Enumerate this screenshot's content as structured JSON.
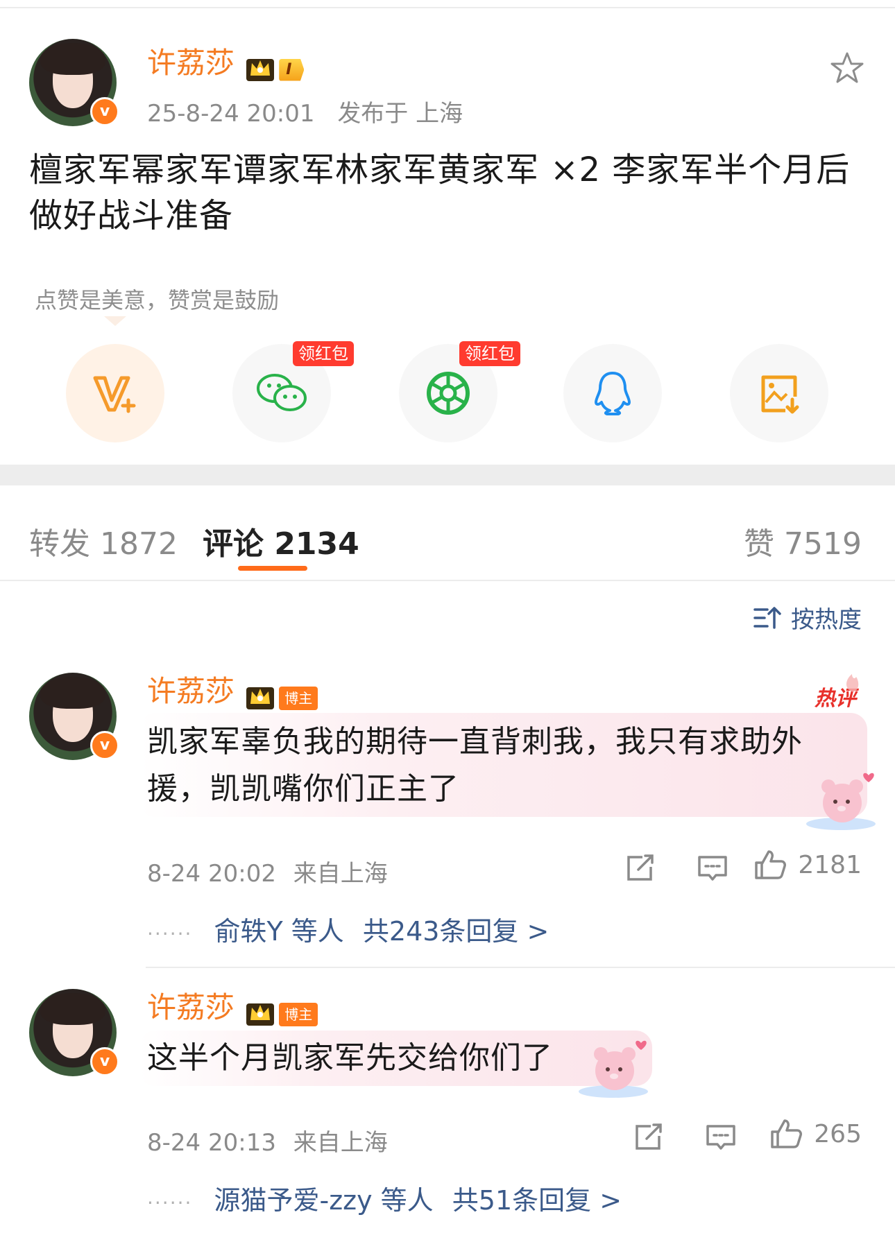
{
  "post": {
    "author": "许荔莎",
    "level_badge": "I",
    "time": "25-8-24 20:01",
    "location_label": "发布于 上海",
    "text_line1": "檀家军幂家军谭家军林家军黄家军 ×2 李家军半个月后",
    "text_line2": "做好战斗准备",
    "reward_tip": "点赞是美意，赞赏是鼓励"
  },
  "share": {
    "redpack_label_1": "领红包",
    "redpack_label_2": "领红包"
  },
  "tabs": {
    "repost": "转发 1872",
    "comment": "评论 2134",
    "like": "赞 7519"
  },
  "sort_label": "按热度",
  "comments": [
    {
      "author": "许荔莎",
      "badge": "博主",
      "hot_label": "热评",
      "line1": "凯家军辜负我的期待一直背刺我，我只有求助外",
      "line2": "援，凯凯嘴你们正主了",
      "time": "8-24 20:02",
      "location": "来自上海",
      "likes": "2181",
      "reply_prefix": "俞轶Y 等人",
      "reply_count": "共243条回复 >"
    },
    {
      "author": "许荔莎",
      "badge": "博主",
      "line1": "这半个月凯家军先交给你们了",
      "time": "8-24 20:13",
      "location": "来自上海",
      "likes": "265",
      "reply_prefix": "源猫予爱-zzy 等人",
      "reply_count": "共51条回复 >"
    }
  ],
  "colors": {
    "accent_orange": "#ff7a1c",
    "username_orange": "#f47b22",
    "link_blue": "#3b5a8a"
  }
}
